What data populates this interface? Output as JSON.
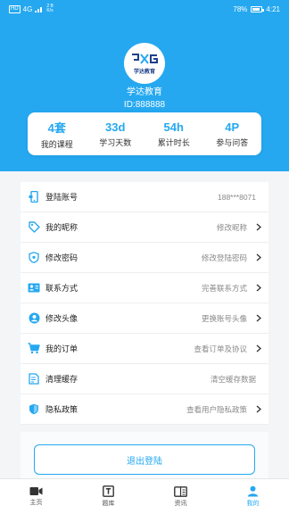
{
  "status_bar": {
    "left_tag": "HD",
    "network": "4G",
    "speed": "2 B K/s",
    "battery": "78%",
    "time": "4:21"
  },
  "profile": {
    "logo_text": "学达教育",
    "name": "学达教育",
    "id": "ID:888888"
  },
  "stats": [
    {
      "value": "4套",
      "label": "我的课程"
    },
    {
      "value": "33d",
      "label": "学习天数"
    },
    {
      "value": "54h",
      "label": "累计时长"
    },
    {
      "value": "4P",
      "label": "参与问答"
    }
  ],
  "menu": [
    {
      "label": "登陆账号",
      "value": "188***8071",
      "icon": "phone-icon"
    },
    {
      "label": "我的昵称",
      "value": "修改昵称",
      "icon": "tag-icon"
    },
    {
      "label": "修改密码",
      "value": "修改登陆密码",
      "icon": "shield-icon"
    },
    {
      "label": "联系方式",
      "value": "完善联系方式",
      "icon": "contact-card-icon"
    },
    {
      "label": "修改头像",
      "value": "更换账号头像",
      "icon": "avatar-icon"
    },
    {
      "label": "我的订单",
      "value": "查看订单及协议",
      "icon": "cart-icon"
    },
    {
      "label": "清理缓存",
      "value": "清空缓存数据",
      "icon": "clean-icon"
    },
    {
      "label": "隐私政策",
      "value": "查看用户隐私政策",
      "icon": "privacy-shield-icon"
    }
  ],
  "logout_label": "退出登陆",
  "tabs": [
    {
      "label": "主页",
      "icon": "video-camera-icon"
    },
    {
      "label": "题库",
      "icon": "question-bank-icon"
    },
    {
      "label": "资讯",
      "icon": "news-icon"
    },
    {
      "label": "我的",
      "icon": "person-icon"
    }
  ],
  "colors": {
    "accent": "#25a8f0",
    "background": "#f4f5f7"
  }
}
